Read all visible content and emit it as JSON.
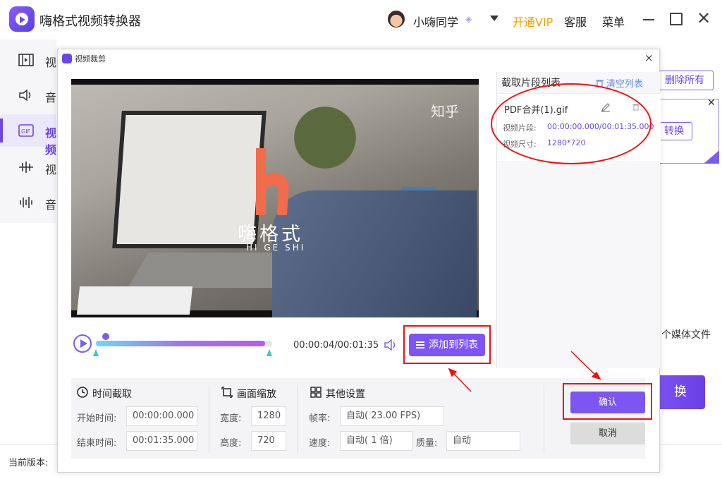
{
  "app": {
    "title": "嗨格式视频转换器",
    "user_name": "小嗨同学",
    "user_badge": "◈",
    "vip_label": "开通VIP",
    "service_label": "客服",
    "menu_label": "菜单",
    "close_glyph": "✕"
  },
  "sidebar": {
    "items": [
      {
        "label": "视",
        "icon": "video-film-icon"
      },
      {
        "label": "音",
        "icon": "speaker-icon"
      },
      {
        "label": "视频",
        "icon": "gif-icon"
      },
      {
        "label": "视",
        "icon": "waveform-cut-icon"
      },
      {
        "label": "音",
        "icon": "audio-wave-icon"
      }
    ],
    "active_index": 2
  },
  "main": {
    "delete_all_label": "删除所有",
    "card_convert_label": "转换",
    "card_close_glyph": "✕",
    "media_count_text": "个媒体文件",
    "convert_all_label": "换",
    "version_label": "当前版本:"
  },
  "dialog": {
    "title": "视频裁剪",
    "close_glyph": "×",
    "preview": {
      "logo_text": "嗨格式",
      "logo_sub": "HI GE SHI",
      "watermark": "知乎"
    },
    "player": {
      "time_readout": "00:00:04/00:01:35",
      "progress_percent": 96,
      "add_to_list_label": "添加到列表"
    },
    "segments": {
      "header": "截取片段列表",
      "clear_label": "清空列表",
      "items": [
        {
          "name": "PDF合并(1).gif",
          "range_label": "视频片段:",
          "range_value": "00:00:00.000/00:01:35.000",
          "size_label": "视频尺寸:",
          "size_value": "1280*720"
        }
      ]
    },
    "settings": {
      "time": {
        "title": "时间截取",
        "start_label": "开始时间:",
        "start_value": "00:00:00.000",
        "end_label": "结束时间:",
        "end_value": "00:01:35.000"
      },
      "scale": {
        "title": "画面缩放",
        "width_label": "宽度:",
        "width_value": "1280",
        "height_label": "高度:",
        "height_value": "720"
      },
      "other": {
        "title": "其他设置",
        "fps_label": "帧率:",
        "fps_value": "自动( 23.00 FPS)",
        "speed_label": "速度:",
        "speed_value": "自动( 1 倍)",
        "quality_label": "质量:",
        "quality_value": "自动"
      }
    },
    "confirm_label": "确认",
    "cancel_label": "取消"
  },
  "colors": {
    "accent": "#7c55f2",
    "annotation": "#e11111",
    "vip": "#f0a000"
  }
}
